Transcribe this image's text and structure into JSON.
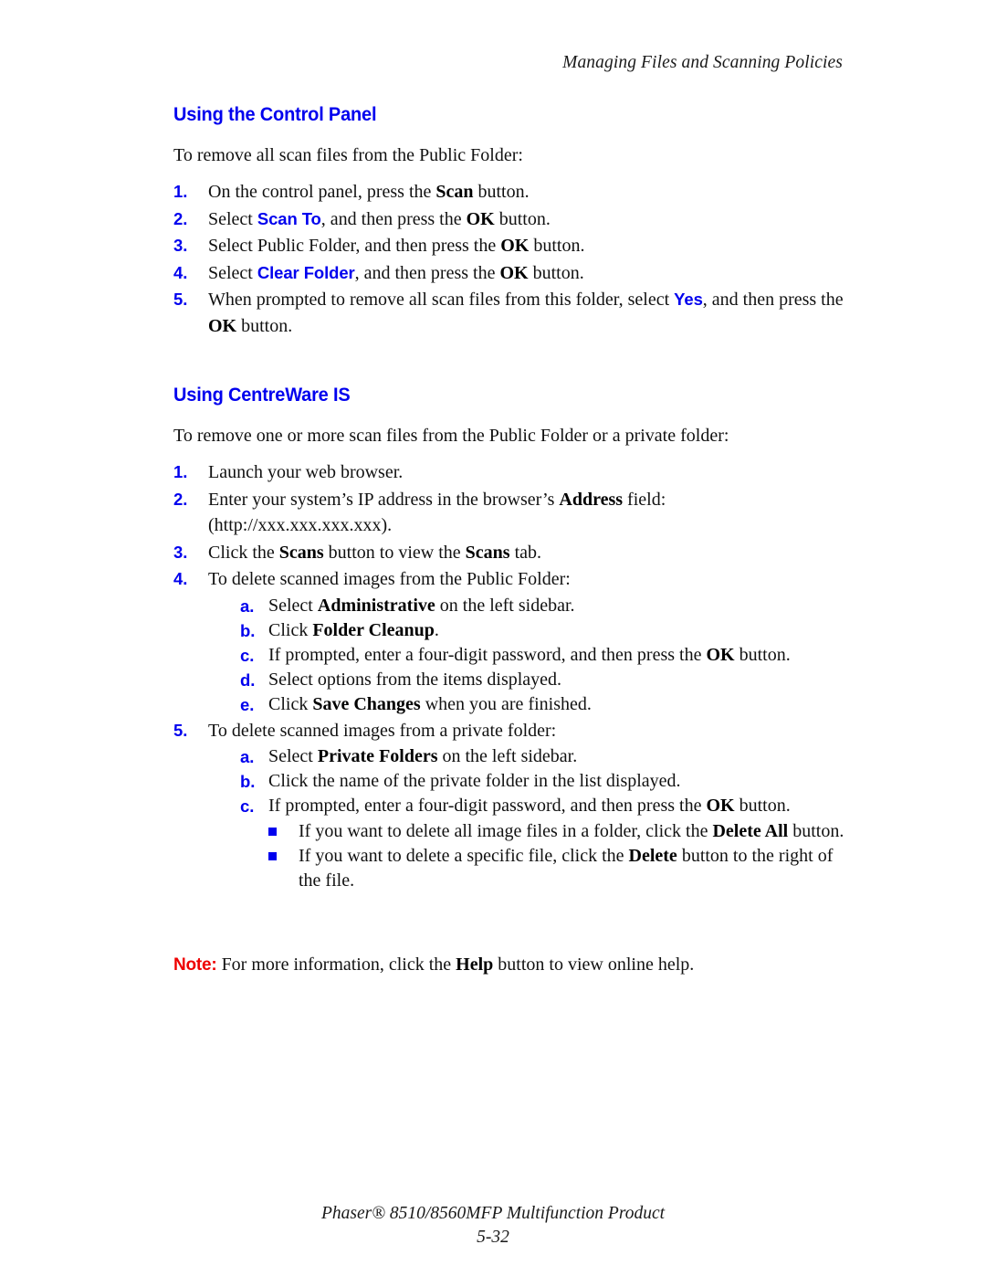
{
  "header": {
    "running_head": "Managing Files and Scanning Policies"
  },
  "sections": [
    {
      "heading": "Using the Control Panel",
      "lead": "To remove all scan files from the Public Folder:",
      "steps": [
        {
          "marker": "1.",
          "parts": [
            {
              "t": "On the control panel, press the ",
              "s": "plain"
            },
            {
              "t": "Scan",
              "s": "bold"
            },
            {
              "t": " button.",
              "s": "plain"
            }
          ]
        },
        {
          "marker": "2.",
          "parts": [
            {
              "t": "Select ",
              "s": "plain"
            },
            {
              "t": "Scan To",
              "s": "ui"
            },
            {
              "t": ", and then press the ",
              "s": "plain"
            },
            {
              "t": "OK",
              "s": "bold"
            },
            {
              "t": " button.",
              "s": "plain"
            }
          ]
        },
        {
          "marker": "3.",
          "parts": [
            {
              "t": "Select Public Folder, and then press the ",
              "s": "plain"
            },
            {
              "t": "OK",
              "s": "bold"
            },
            {
              "t": " button.",
              "s": "plain"
            }
          ]
        },
        {
          "marker": "4.",
          "parts": [
            {
              "t": "Select ",
              "s": "plain"
            },
            {
              "t": "Clear Folder",
              "s": "ui"
            },
            {
              "t": ", and then press the ",
              "s": "plain"
            },
            {
              "t": "OK",
              "s": "bold"
            },
            {
              "t": " button.",
              "s": "plain"
            }
          ]
        },
        {
          "marker": "5.",
          "parts": [
            {
              "t": "When prompted to remove all scan files from this folder, select ",
              "s": "plain"
            },
            {
              "t": "Yes",
              "s": "ui"
            },
            {
              "t": ", and then press the ",
              "s": "plain"
            },
            {
              "t": "OK",
              "s": "bold"
            },
            {
              "t": " button.",
              "s": "plain"
            }
          ]
        }
      ]
    },
    {
      "heading": "Using CentreWare IS",
      "lead": "To remove one or more scan files from the Public Folder or a private folder:",
      "steps": [
        {
          "marker": "1.",
          "parts": [
            {
              "t": "Launch your web browser.",
              "s": "plain"
            }
          ]
        },
        {
          "marker": "2.",
          "parts": [
            {
              "t": "Enter your system’s IP address in the browser’s ",
              "s": "plain"
            },
            {
              "t": "Address",
              "s": "bold"
            },
            {
              "t": " field: (http://xxx.xxx.xxx.xxx).",
              "s": "plain"
            }
          ]
        },
        {
          "marker": "3.",
          "parts": [
            {
              "t": "Click the ",
              "s": "plain"
            },
            {
              "t": "Scans",
              "s": "bold"
            },
            {
              "t": " button to view the ",
              "s": "plain"
            },
            {
              "t": "Scans",
              "s": "bold"
            },
            {
              "t": " tab.",
              "s": "plain"
            }
          ]
        },
        {
          "marker": "4.",
          "parts": [
            {
              "t": "To delete scanned images from the Public Folder:",
              "s": "plain"
            }
          ],
          "substeps": [
            {
              "marker": "a.",
              "parts": [
                {
                  "t": "Select ",
                  "s": "plain"
                },
                {
                  "t": "Administrative",
                  "s": "bold"
                },
                {
                  "t": " on the left sidebar.",
                  "s": "plain"
                }
              ]
            },
            {
              "marker": "b.",
              "parts": [
                {
                  "t": "Click ",
                  "s": "plain"
                },
                {
                  "t": "Folder Cleanup",
                  "s": "bold"
                },
                {
                  "t": ".",
                  "s": "plain"
                }
              ]
            },
            {
              "marker": "c.",
              "parts": [
                {
                  "t": "If prompted, enter a four-digit password, and then press the ",
                  "s": "plain"
                },
                {
                  "t": "OK",
                  "s": "bold"
                },
                {
                  "t": " button.",
                  "s": "plain"
                }
              ]
            },
            {
              "marker": "d.",
              "parts": [
                {
                  "t": "Select options from the items displayed.",
                  "s": "plain"
                }
              ]
            },
            {
              "marker": "e.",
              "parts": [
                {
                  "t": "Click ",
                  "s": "plain"
                },
                {
                  "t": "Save Changes",
                  "s": "bold"
                },
                {
                  "t": " when you are finished.",
                  "s": "plain"
                }
              ]
            }
          ]
        },
        {
          "marker": "5.",
          "parts": [
            {
              "t": "To delete scanned images from a private folder:",
              "s": "plain"
            }
          ],
          "substeps": [
            {
              "marker": "a.",
              "parts": [
                {
                  "t": "Select ",
                  "s": "plain"
                },
                {
                  "t": "Private Folders",
                  "s": "bold"
                },
                {
                  "t": " on the left sidebar.",
                  "s": "plain"
                }
              ]
            },
            {
              "marker": "b.",
              "parts": [
                {
                  "t": "Click the name of the private folder in the list displayed.",
                  "s": "plain"
                }
              ]
            },
            {
              "marker": "c.",
              "parts": [
                {
                  "t": "If prompted, enter a four-digit password, and then press the ",
                  "s": "plain"
                },
                {
                  "t": "OK",
                  "s": "bold"
                },
                {
                  "t": " button.",
                  "s": "plain"
                }
              ]
            }
          ],
          "bullets": [
            {
              "icon": "square-bullet-icon",
              "parts": [
                {
                  "t": "If you want to delete all image files in a folder, click the ",
                  "s": "plain"
                },
                {
                  "t": "Delete All",
                  "s": "bold"
                },
                {
                  "t": " button.",
                  "s": "plain"
                }
              ]
            },
            {
              "icon": "square-bullet-icon",
              "parts": [
                {
                  "t": "If you want to delete a specific file, click the ",
                  "s": "plain"
                },
                {
                  "t": "Delete",
                  "s": "bold"
                },
                {
                  "t": " button to the right of the file.",
                  "s": "plain"
                }
              ]
            }
          ]
        }
      ]
    }
  ],
  "note": {
    "label": "Note:",
    "parts": [
      {
        "t": " For more information, click the ",
        "s": "plain"
      },
      {
        "t": "Help",
        "s": "bold"
      },
      {
        "t": " button to view online help.",
        "s": "plain"
      }
    ]
  },
  "footer": {
    "product": "Phaser® 8510/8560MFP Multifunction Product",
    "page_number": "5-32"
  },
  "colors": {
    "heading_blue": "#0000EE",
    "ui_term_blue": "#0000EE",
    "note_red": "#EE0000",
    "body_text": "#111111",
    "page_background": "#FFFFFF"
  }
}
